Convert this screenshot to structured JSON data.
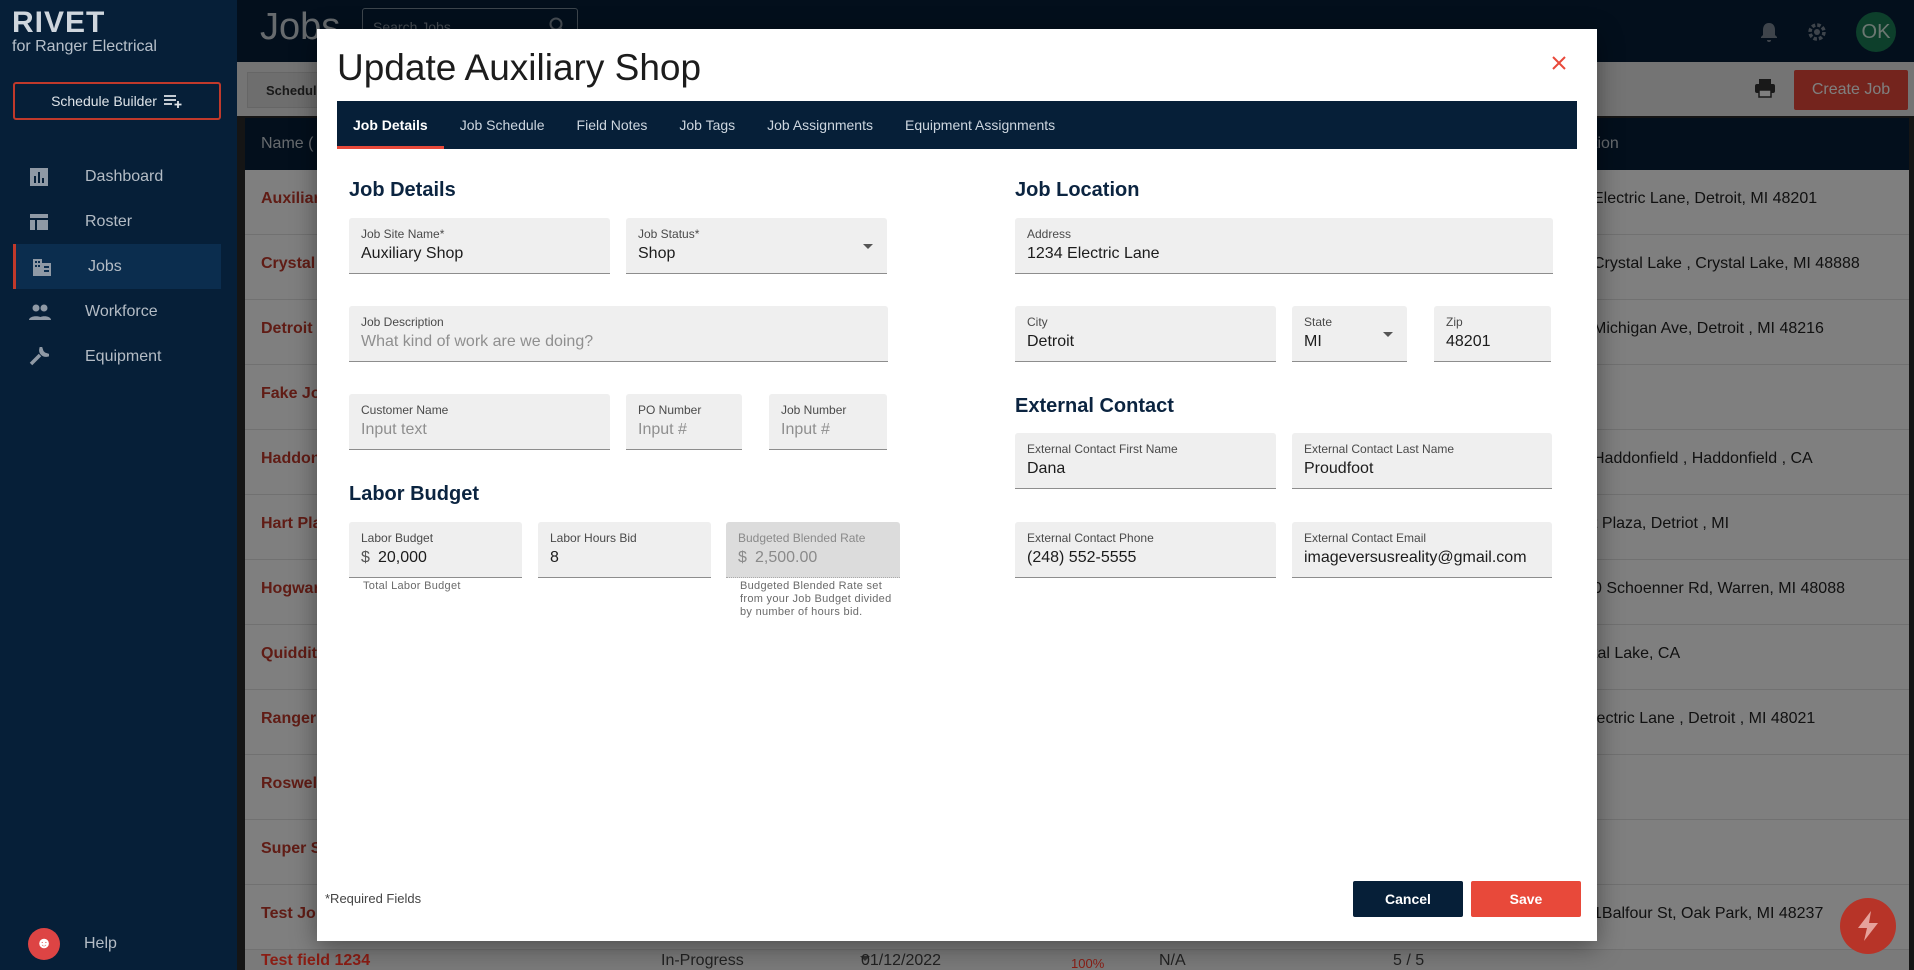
{
  "app": {
    "brand_name": "RIVET",
    "brand_sub": "for Ranger Electrical",
    "schedule_builder": "Schedule Builder",
    "page_title": "Jobs",
    "search_placeholder": "Search Jobs",
    "avatar_initials": "OK",
    "create_job": "Create Job",
    "subtab": "Schedule",
    "help": "Help"
  },
  "nav": {
    "items": [
      {
        "label": "Dashboard",
        "icon": "dashboard-icon"
      },
      {
        "label": "Roster",
        "icon": "roster-icon"
      },
      {
        "label": "Jobs",
        "icon": "jobs-icon",
        "active": true
      },
      {
        "label": "Workforce",
        "icon": "workforce-icon"
      },
      {
        "label": "Equipment",
        "icon": "equipment-icon"
      }
    ]
  },
  "table": {
    "header_name": "Name (",
    "header_location": "tion",
    "rows": [
      {
        "name": "Auxiliar",
        "location": "Electric Lane, Detroit, MI 48201"
      },
      {
        "name": "Crystal",
        "location": "Crystal Lake , Crystal Lake, MI 48888"
      },
      {
        "name": "Detroit",
        "location": "Michigan Ave, Detroit , MI 48216"
      },
      {
        "name": "Fake Jo",
        "location": ""
      },
      {
        "name": "Haddon",
        "location": "Haddonfield , Haddonfield , CA"
      },
      {
        "name": "Hart Pla",
        "location": "t Plaza, Detriot , MI"
      },
      {
        "name": "Hogwar",
        "location": "0 Schoenner Rd, Warren, MI 48088"
      },
      {
        "name": "Quiddit",
        "location": "tal Lake, CA"
      },
      {
        "name": "Ranger",
        "location": "lectric Lane , Detroit , MI 48021"
      },
      {
        "name": "Roswell",
        "location": ""
      },
      {
        "name": "Super S",
        "location": ""
      },
      {
        "name": "Test Jol",
        "location": "1Balfour St, Oak Park, MI 48237"
      }
    ],
    "last_row": {
      "name": "Test field 1234",
      "status": "In-Progress",
      "date": "01/12/2022",
      "percent": "100%",
      "na": "N/A",
      "ratio": "5 / 5"
    }
  },
  "modal": {
    "title": "Update Auxiliary Shop",
    "tabs": [
      "Job Details",
      "Job Schedule",
      "Field Notes",
      "Job Tags",
      "Job Assignments",
      "Equipment Assignments"
    ],
    "job_details": {
      "section": "Job Details",
      "site_name_label": "Job Site Name*",
      "site_name_value": "Auxiliary Shop",
      "status_label": "Job Status*",
      "status_value": "Shop",
      "description_label": "Job Description",
      "description_placeholder": "What kind of work are we doing?",
      "customer_label": "Customer Name",
      "customer_placeholder": "Input text",
      "po_label": "PO Number",
      "po_placeholder": "Input #",
      "job_number_label": "Job Number",
      "job_number_placeholder": "Input #"
    },
    "labor_budget": {
      "section": "Labor Budget",
      "budget_label": "Labor Budget",
      "budget_prefix": "$",
      "budget_value": "20,000",
      "budget_helper": "Total Labor Budget",
      "hours_label": "Labor Hours Bid",
      "hours_value": "8",
      "rate_label": "Budgeted Blended Rate",
      "rate_prefix": "$",
      "rate_value": "2,500.00",
      "rate_helper": "Budgeted Blended Rate set from your Job Budget divided by number of hours bid."
    },
    "job_location": {
      "section": "Job Location",
      "address_label": "Address",
      "address_value": "1234 Electric Lane",
      "city_label": "City",
      "city_value": "Detroit",
      "state_label": "State",
      "state_value": "MI",
      "zip_label": "Zip",
      "zip_value": "48201"
    },
    "external_contact": {
      "section": "External Contact",
      "first_label": "External Contact First Name",
      "first_value": "Dana",
      "last_label": "External Contact Last Name",
      "last_value": "Proudfoot",
      "phone_label": "External Contact Phone",
      "phone_value": "(248) 552-5555",
      "email_label": "External Contact Email",
      "email_value": "imageversusreality@gmail.com"
    },
    "required_note": "*Required Fields",
    "cancel": "Cancel",
    "save": "Save"
  },
  "colors": {
    "navy": "#061f38",
    "accent_red": "#e8493a"
  }
}
